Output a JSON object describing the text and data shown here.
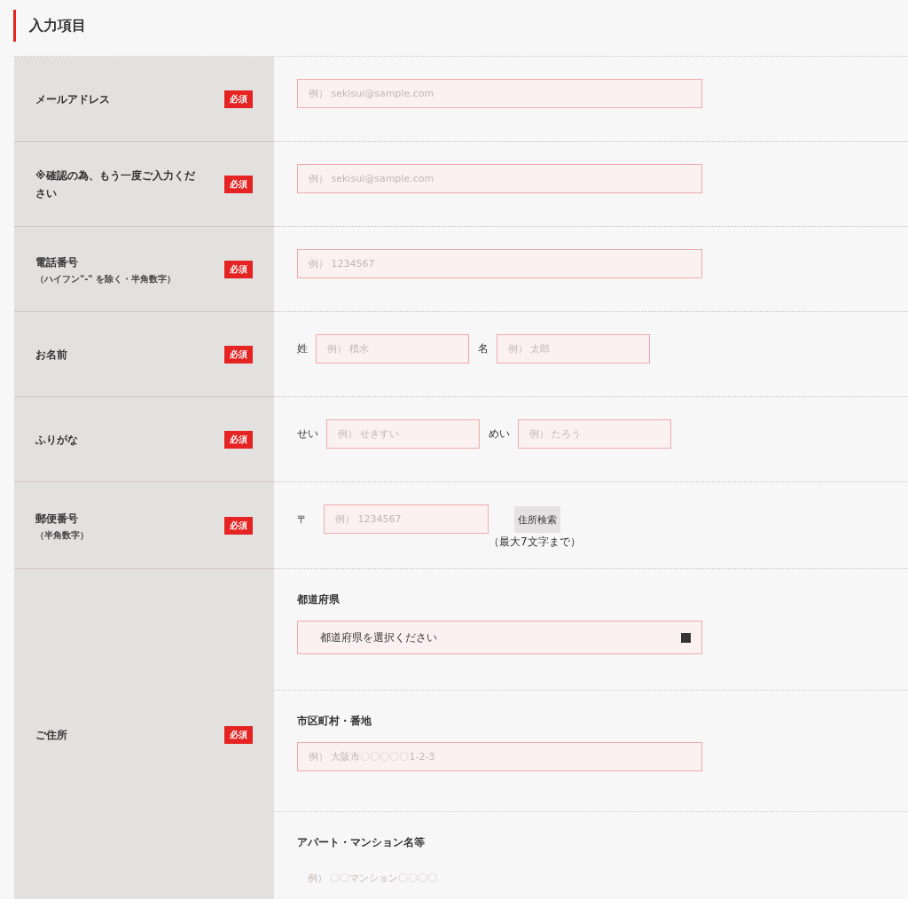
{
  "heading": "入力項目",
  "rows": [
    {
      "label": "メールアドレス",
      "badge": "必須",
      "kind": "single",
      "fields": [
        {
          "placeholder": "例） sekisui@sample.com"
        }
      ]
    },
    {
      "label": "※確認の為、もう一度ご入力ください",
      "badge": "必須",
      "kind": "single",
      "fields": [
        {
          "placeholder": "例） sekisui@sample.com"
        }
      ]
    },
    {
      "label": "電話番号",
      "note": "（ハイフン\"-\" を除く・半角数字）",
      "badge": "必須",
      "kind": "single",
      "fields": [
        {
          "placeholder": "例） 1234567"
        }
      ]
    },
    {
      "label": "お名前",
      "badge": "必須",
      "kind": "pair",
      "fields": [
        {
          "prefix": "姓",
          "placeholder": "例） 積水"
        },
        {
          "prefix": "名",
          "placeholder": "例） 太郎"
        }
      ]
    },
    {
      "label": "ふりがな",
      "badge": "必須",
      "kind": "pair",
      "fields": [
        {
          "prefix": "せい",
          "placeholder": "例） せきすい"
        },
        {
          "prefix": "めい",
          "placeholder": "例） たろう"
        }
      ]
    },
    {
      "label": "郵便番号",
      "note": "（半角数字）",
      "badge": "必須",
      "kind": "postal",
      "fields": [
        {
          "prefix": "〒",
          "placeholder": "例） 1234567",
          "button": "住所検索",
          "hint": "（最大7文字まで）"
        }
      ]
    },
    {
      "label": "ご住所",
      "badge": "必須",
      "kind": "address",
      "fields": [
        {
          "kind": "select",
          "title": "都道府県",
          "value": "都道府県を選択ください"
        },
        {
          "kind": "input",
          "title": "市区町村・番地",
          "placeholder": "例） 大阪市〇〇〇〇〇1-2-3"
        },
        {
          "kind": "plain",
          "title": "アパート・マンション名等",
          "placeholder": "例） 〇〇マンション〇〇〇〇"
        }
      ]
    }
  ]
}
